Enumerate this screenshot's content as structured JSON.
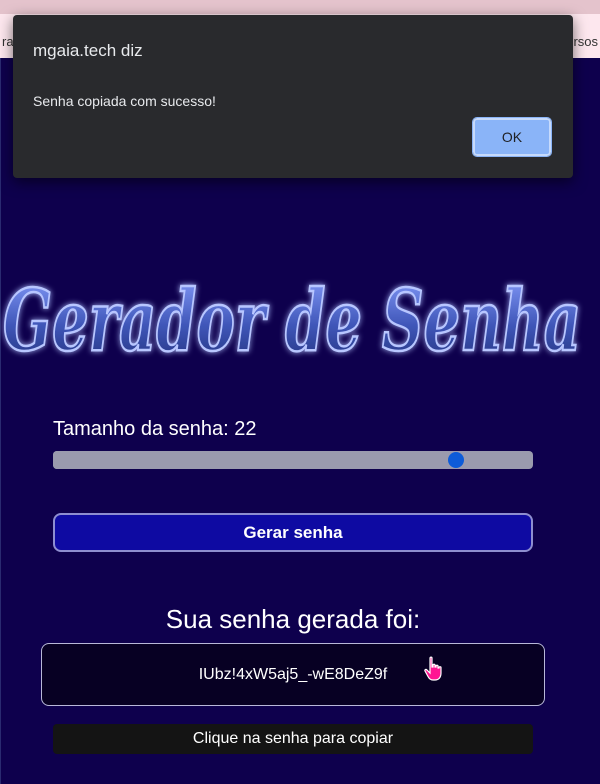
{
  "banner": {
    "left_fragment": "ra",
    "right_fragment": "rsos"
  },
  "dialog": {
    "title": "mgaia.tech diz",
    "message": "Senha copiada com sucesso!",
    "ok_label": "OK"
  },
  "app": {
    "title": "Gerador de Senha",
    "size_label": "Tamanho da senha: 22",
    "slider_level": 0.84,
    "generate_label": "Gerar senha",
    "result_heading": "Sua senha gerada foi:",
    "password": "IUbz!4xW5aj5_-wE8DeZ9f",
    "copy_hint": "Clique na senha para copiar"
  },
  "colors": {
    "background": "#0e004d",
    "title_fill": "#3f56b8",
    "title_glow": "#9fb4ff",
    "button": "#0e0aa2",
    "slider_thumb": "#0d5bd8",
    "dialog_button": "#8ab4f8",
    "cursor": "#ff1493"
  },
  "icons": {
    "cursor": "hand-pointer-icon"
  }
}
